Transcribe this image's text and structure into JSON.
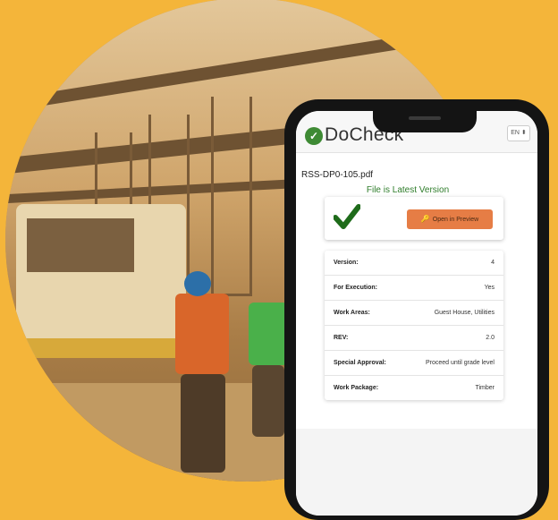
{
  "app": {
    "logo_mark": "✓",
    "logo_text": "DoCheck",
    "language": "EN ⬍"
  },
  "document": {
    "filename": "RSS-DP0-105.pdf",
    "status": "File is Latest Version",
    "open_preview_label": "Open in Preview"
  },
  "details": [
    {
      "label": "Version:",
      "value": "4"
    },
    {
      "label": "For Execution:",
      "value": "Yes"
    },
    {
      "label": "Work Areas:",
      "value": "Guest House, Utilities"
    },
    {
      "label": "REV:",
      "value": "2.0"
    },
    {
      "label": "Special Approval:",
      "value": "Proceed until grade level"
    },
    {
      "label": "Work Package:",
      "value": "Timber"
    }
  ],
  "colors": {
    "background": "#f4b53a",
    "accent_green": "#2f7d2b",
    "button_orange": "#e67d45"
  },
  "icons": {
    "check": "check-icon",
    "key": "key-icon"
  }
}
